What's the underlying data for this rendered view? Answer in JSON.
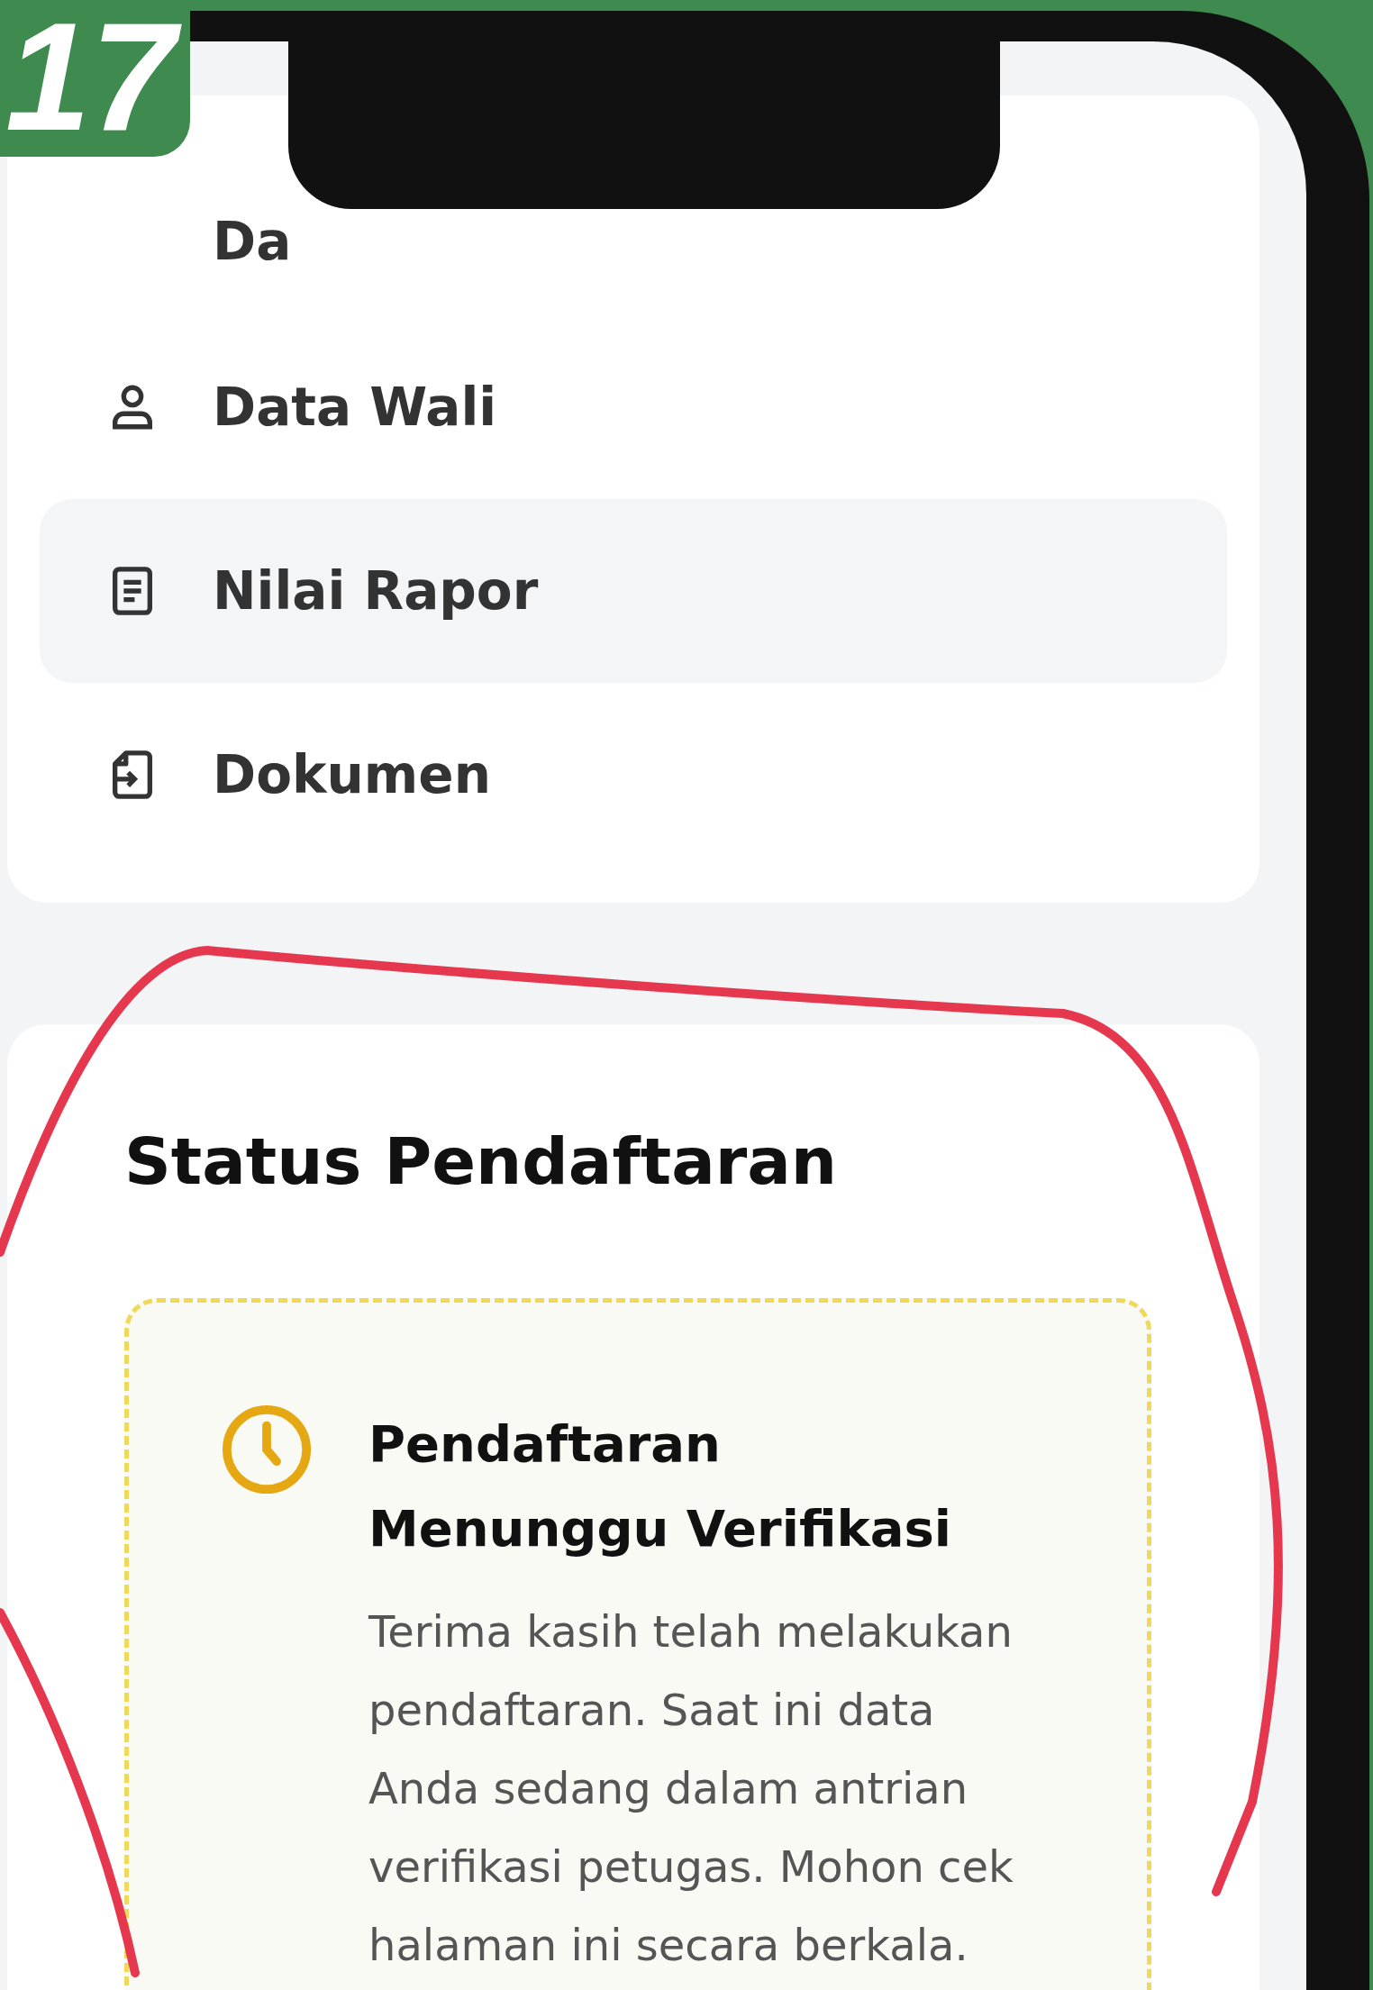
{
  "badge": "17",
  "menu": [
    {
      "label": "Da",
      "kind": "hidden",
      "selected": false
    },
    {
      "label": "Data Wali",
      "kind": "person",
      "selected": false
    },
    {
      "label": "Nilai Rapor",
      "kind": "document",
      "selected": true
    },
    {
      "label": "Dokumen",
      "kind": "file",
      "selected": false
    }
  ],
  "status": {
    "title": "Status Pendaftaran",
    "heading": "Pendaftaran Menunggu Verifikasi",
    "message": "Terima kasih telah melakukan pendaftaran. Saat ini data Anda sedang dalam antrian verifikasi petugas. Mohon cek halaman ini secara berkala."
  }
}
